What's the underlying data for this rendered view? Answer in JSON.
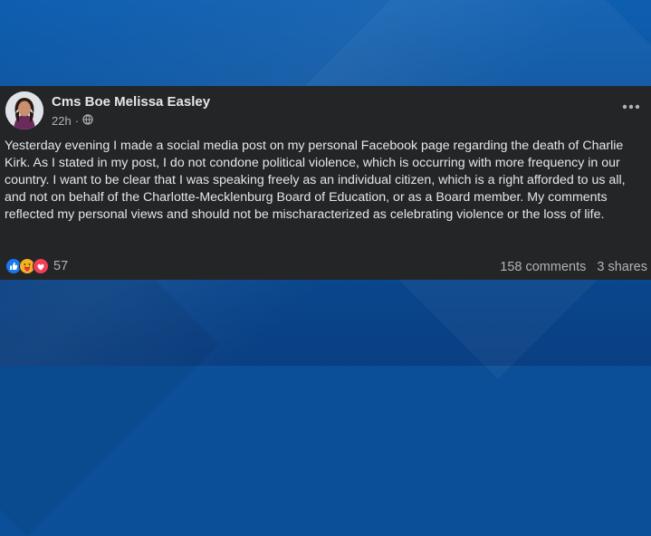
{
  "post": {
    "author": "Cms Boe Melissa Easley",
    "time": "22h",
    "audience_icon": "globe-icon",
    "more_icon": "more-options-icon",
    "text": "Yesterday evening I made a social media post on my personal Facebook page regarding the death of Charlie Kirk. As I stated in my post, I do not condone political violence, which is occurring with more frequency in our country. I want to be clear that I was speaking freely as an individual citizen, which is a right afforded to us all, and not on behalf of the Charlotte-Mecklenburg Board of Education, or as a Board member. My comments reflected my personal views and should not be mischaracterized as celebrating violence or the loss of life.",
    "reactions": {
      "icons": [
        "like-icon",
        "care-icon",
        "love-icon"
      ],
      "count": "57"
    },
    "comments": "158 comments",
    "shares": "3 shares"
  },
  "colors": {
    "post_bg": "#242526",
    "text": "#e4e6eb",
    "secondary_text": "#b0b3b8",
    "background_blue": "#0b4f98"
  }
}
